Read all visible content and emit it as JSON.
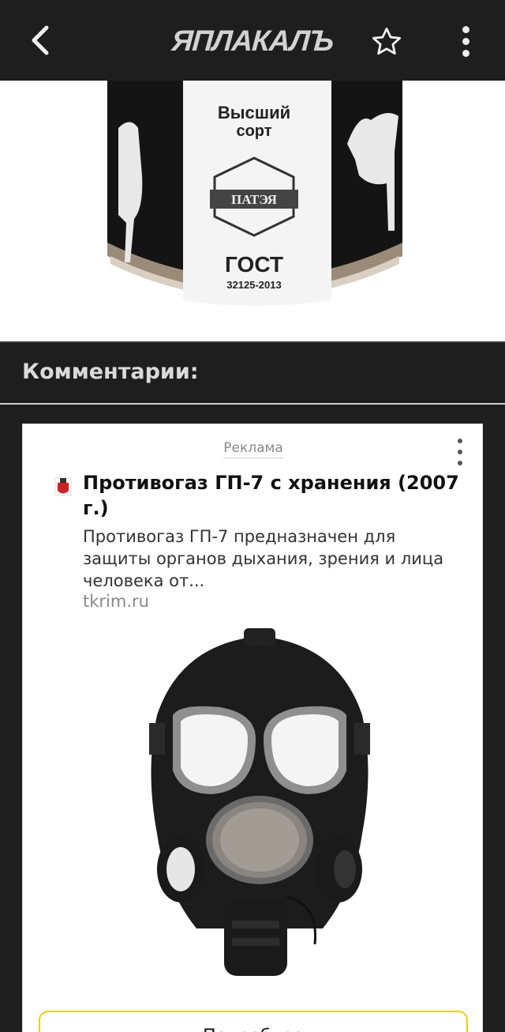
{
  "topbar": {
    "logo_text": "ЯПЛАКАЛЪ",
    "back_icon": "chevron-left-icon",
    "favorite_icon": "star-outline-icon",
    "menu_icon": "more-vertical-icon"
  },
  "post": {
    "can_label_grade": "Высший\nсорт",
    "can_brand": "ПАТЭЯ",
    "can_standard": "ГОСТ",
    "can_standard_number": "32125-2013"
  },
  "comments": {
    "title": "Комментарии:"
  },
  "ad": {
    "label": "Реклама",
    "title": "Противогаз ГП-7 с хранения (2007 г.)",
    "description": "Противогаз ГП-7 предназначен для защиты органов дыхания, зрения и лица человека от...",
    "domain": "tkrim.ru",
    "cta_label": "Подробнее"
  },
  "colors": {
    "topbar_bg": "#1e1e1e",
    "card_bg": "#ffffff",
    "cta_border": "#f0d000"
  }
}
